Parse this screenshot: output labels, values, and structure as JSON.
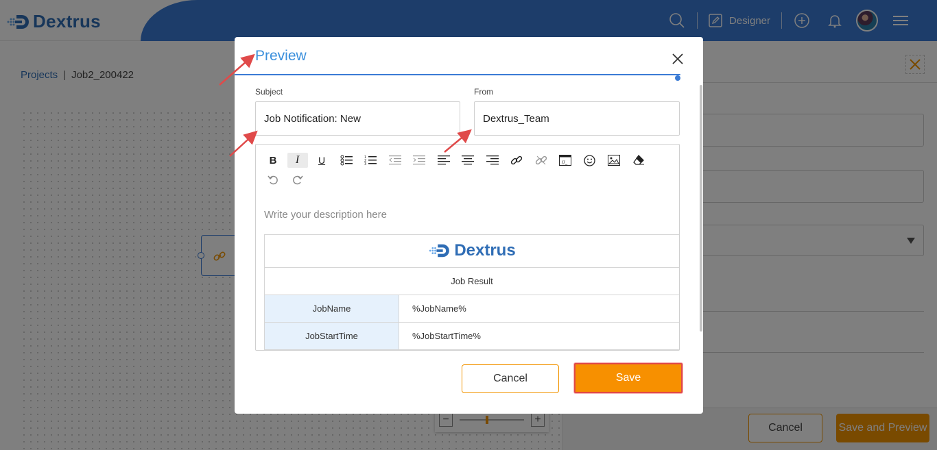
{
  "app": {
    "logo_text": "Dextrus",
    "brand_color": "#2f6db5",
    "header_color": "#3a7bd5",
    "accent_color": "#f29400"
  },
  "header": {
    "icons": [
      "search-icon",
      "edit-icon",
      "add-circle-icon",
      "bell-icon",
      "avatar",
      "menu-icon"
    ],
    "designer_label": "Designer"
  },
  "breadcrumb": {
    "projects": "Projects",
    "separator": "|",
    "current": "Job2_200422"
  },
  "side_panel": {
    "cancel_label": "Cancel",
    "save_preview_label": "Save and Preview"
  },
  "modal": {
    "title": "Preview",
    "subject_label": "Subject",
    "subject_value": "Job Notification: New",
    "from_label": "From",
    "from_value": "Dextrus_Team",
    "toolbar": [
      {
        "name": "bold-icon",
        "glyph": "B"
      },
      {
        "name": "italic-icon",
        "glyph": "I"
      },
      {
        "name": "underline-icon",
        "glyph": "U"
      },
      {
        "name": "bullet-list-icon",
        "glyph": "list"
      },
      {
        "name": "numbered-list-icon",
        "glyph": "olist"
      },
      {
        "name": "outdent-icon",
        "glyph": "outdent"
      },
      {
        "name": "indent-icon",
        "glyph": "indent"
      },
      {
        "name": "align-left-icon",
        "glyph": "aleft"
      },
      {
        "name": "align-center-icon",
        "glyph": "acenter"
      },
      {
        "name": "align-right-icon",
        "glyph": "aright"
      },
      {
        "name": "link-icon",
        "glyph": "link"
      },
      {
        "name": "unlink-icon",
        "glyph": "unlink"
      },
      {
        "name": "code-view-icon",
        "glyph": "code"
      },
      {
        "name": "emoji-icon",
        "glyph": "emoji"
      },
      {
        "name": "image-icon",
        "glyph": "image"
      },
      {
        "name": "eraser-icon",
        "glyph": "eraser"
      },
      {
        "name": "undo-icon",
        "glyph": "undo"
      },
      {
        "name": "redo-icon",
        "glyph": "redo"
      }
    ],
    "editor_placeholder": "Write your description here",
    "email": {
      "brand": "Dextrus",
      "heading": "Job Result",
      "rows": [
        {
          "key": "JobName",
          "value": "%JobName%"
        },
        {
          "key": "JobStartTime",
          "value": "%JobStartTime%"
        }
      ]
    },
    "cancel_label": "Cancel",
    "save_label": "Save"
  },
  "annotation_color": "#e04a4a"
}
